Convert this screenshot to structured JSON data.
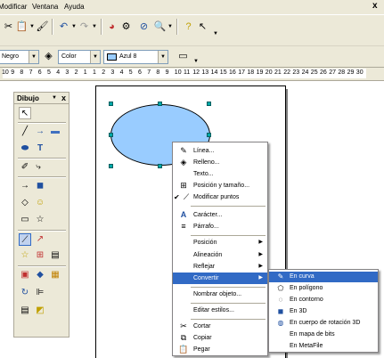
{
  "menubar": {
    "items": [
      {
        "label": "Modificar"
      },
      {
        "label": "Ventana"
      },
      {
        "label": "Ayuda"
      }
    ],
    "close": "x"
  },
  "format_toolbar": {
    "line_style": "Negro",
    "fill_type": "Color",
    "fill_color": "Azul 8"
  },
  "ruler": {
    "numbers": [
      "10",
      "9",
      "8",
      "7",
      "6",
      "5",
      "4",
      "3",
      "2",
      "1",
      "1",
      "2",
      "3",
      "4",
      "5",
      "6",
      "7",
      "8",
      "9",
      "10",
      "11",
      "12",
      "13",
      "14",
      "15",
      "16",
      "17",
      "18",
      "19",
      "20",
      "21",
      "22",
      "23",
      "24",
      "25",
      "26",
      "27",
      "28",
      "29",
      "30"
    ]
  },
  "drawing_toolbar": {
    "title": "Dibujo",
    "close": "x"
  },
  "shape": {
    "fill_color": "#99ccff"
  },
  "context_menu": {
    "items": [
      {
        "label": "Línea...",
        "icon": "line-style-icon"
      },
      {
        "label": "Relleno...",
        "icon": "fill-bucket-icon"
      },
      {
        "label": "Texto...",
        "icon": ""
      },
      {
        "label": "Posición y tamaño...",
        "icon": "position-size-icon"
      },
      {
        "label": "Modificar puntos",
        "icon": "edit-points-icon"
      },
      {
        "label": "Carácter...",
        "icon": "character-icon"
      },
      {
        "label": "Párrafo...",
        "icon": "paragraph-icon"
      },
      {
        "label": "Posición",
        "icon": ""
      },
      {
        "label": "Alineación",
        "icon": ""
      },
      {
        "label": "Reflejar",
        "icon": ""
      },
      {
        "label": "Convertir",
        "icon": ""
      },
      {
        "label": "Nombrar objeto...",
        "icon": ""
      },
      {
        "label": "Editar estilos...",
        "icon": ""
      },
      {
        "label": "Cortar",
        "icon": "scissors-icon"
      },
      {
        "label": "Copiar",
        "icon": "copy-icon"
      },
      {
        "label": "Pegar",
        "icon": "paste-icon"
      }
    ]
  },
  "submenu": {
    "items": [
      {
        "label": "En curva"
      },
      {
        "label": "En polígono"
      },
      {
        "label": "En contorno"
      },
      {
        "label": "En 3D"
      },
      {
        "label": "En cuerpo de rotación 3D"
      },
      {
        "label": "En mapa de bits"
      },
      {
        "label": "En MetaFile"
      }
    ]
  },
  "colors": {
    "menu_highlight": "#316ac5",
    "toolbar_bg": "#ece9d8",
    "handle": "#00a8a8"
  }
}
